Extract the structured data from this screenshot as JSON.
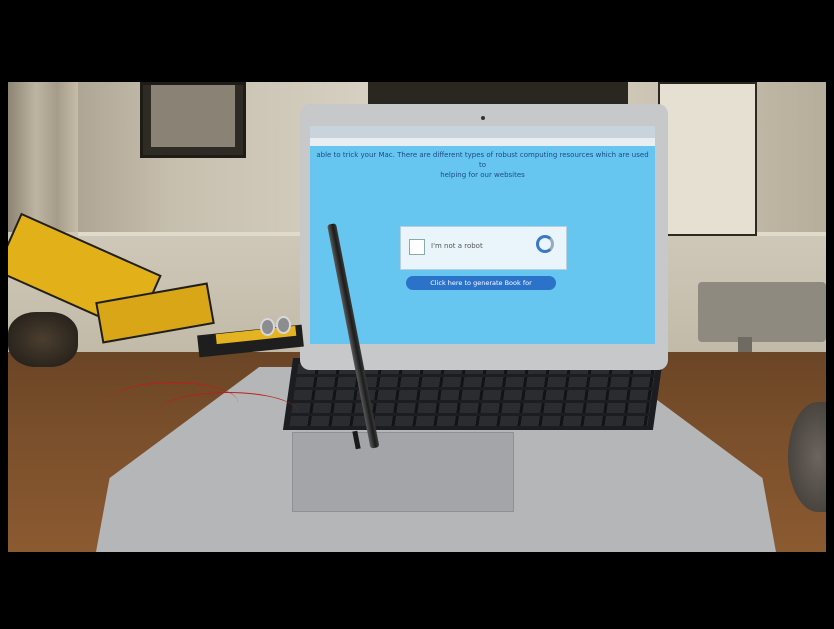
{
  "video": {
    "screen": {
      "page_text_line1": "able to trick your Mac. There are different types of robust computing resources which are used to",
      "page_text_line2": "helping for our websites",
      "captcha_label": "I'm not a robot",
      "button_label": "Click here to generate Book for"
    }
  },
  "colors": {
    "screen": "#67c6ef",
    "button": "#2b72c9",
    "robot": "#e2b11a",
    "table": "#7a4f2b"
  }
}
